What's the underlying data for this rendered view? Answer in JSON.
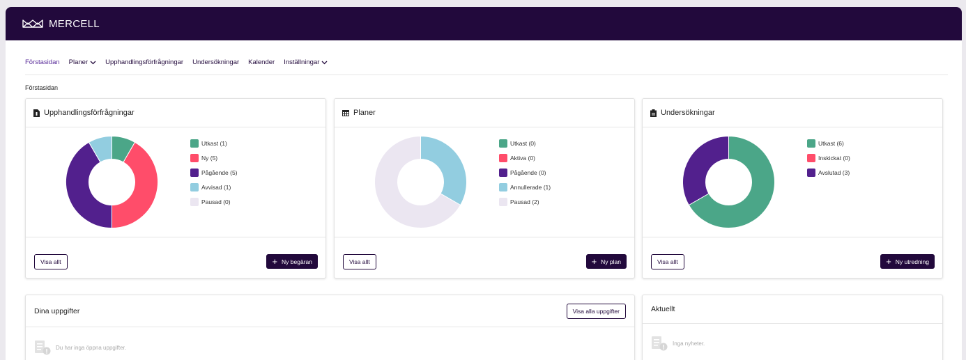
{
  "brand": {
    "name": "MERCELL",
    "logo_icon": "mercell-logo-icon"
  },
  "nav": {
    "items": [
      {
        "label": "Förstasidan",
        "active": true,
        "dropdown": false
      },
      {
        "label": "Planer",
        "active": false,
        "dropdown": true
      },
      {
        "label": "Upphandlingsförfrågningar",
        "active": false,
        "dropdown": false
      },
      {
        "label": "Undersökningar",
        "active": false,
        "dropdown": false
      },
      {
        "label": "Kalender",
        "active": false,
        "dropdown": false
      },
      {
        "label": "Inställningar",
        "active": false,
        "dropdown": true
      }
    ]
  },
  "breadcrumb": "Förstasidan",
  "cards": [
    {
      "title": "Upphandlingsförfrågningar",
      "icon": "file-icon",
      "legend": [
        {
          "label": "Utkast (1)",
          "value": 1,
          "color": "#4ba688"
        },
        {
          "label": "Ny (5)",
          "value": 5,
          "color": "#ff4d6a"
        },
        {
          "label": "Pågående (5)",
          "value": 5,
          "color": "#52208d"
        },
        {
          "label": "Avvisad (1)",
          "value": 1,
          "color": "#92cde0"
        },
        {
          "label": "Pausad (0)",
          "value": 0,
          "color": "#ebe6f1"
        }
      ],
      "view_all": "Visa allt",
      "action": "Ny begäran"
    },
    {
      "title": "Planer",
      "icon": "calendar-icon",
      "legend": [
        {
          "label": "Utkast (0)",
          "value": 0,
          "color": "#4ba688"
        },
        {
          "label": "Aktiva (0)",
          "value": 0,
          "color": "#ff4d6a"
        },
        {
          "label": "Pågående (0)",
          "value": 0,
          "color": "#52208d"
        },
        {
          "label": "Annullerade (1)",
          "value": 1,
          "color": "#92cde0"
        },
        {
          "label": "Pausad (2)",
          "value": 2,
          "color": "#ebe6f1"
        }
      ],
      "view_all": "Visa allt",
      "action": "Ny plan"
    },
    {
      "title": "Undersökningar",
      "icon": "clipboard-icon",
      "legend": [
        {
          "label": "Utkast (6)",
          "value": 6,
          "color": "#4ba688"
        },
        {
          "label": "Inskickat (0)",
          "value": 0,
          "color": "#ff4d6a"
        },
        {
          "label": "Avslutad (3)",
          "value": 3,
          "color": "#52208d"
        }
      ],
      "view_all": "Visa allt",
      "action": "Ny utredning"
    }
  ],
  "tasks": {
    "title": "Dina uppgifter",
    "button": "Visa alla uppgifter",
    "empty": "Du har inga öppna uppgifter."
  },
  "news": {
    "title": "Aktuellt",
    "empty": "Inga nyheter."
  }
}
